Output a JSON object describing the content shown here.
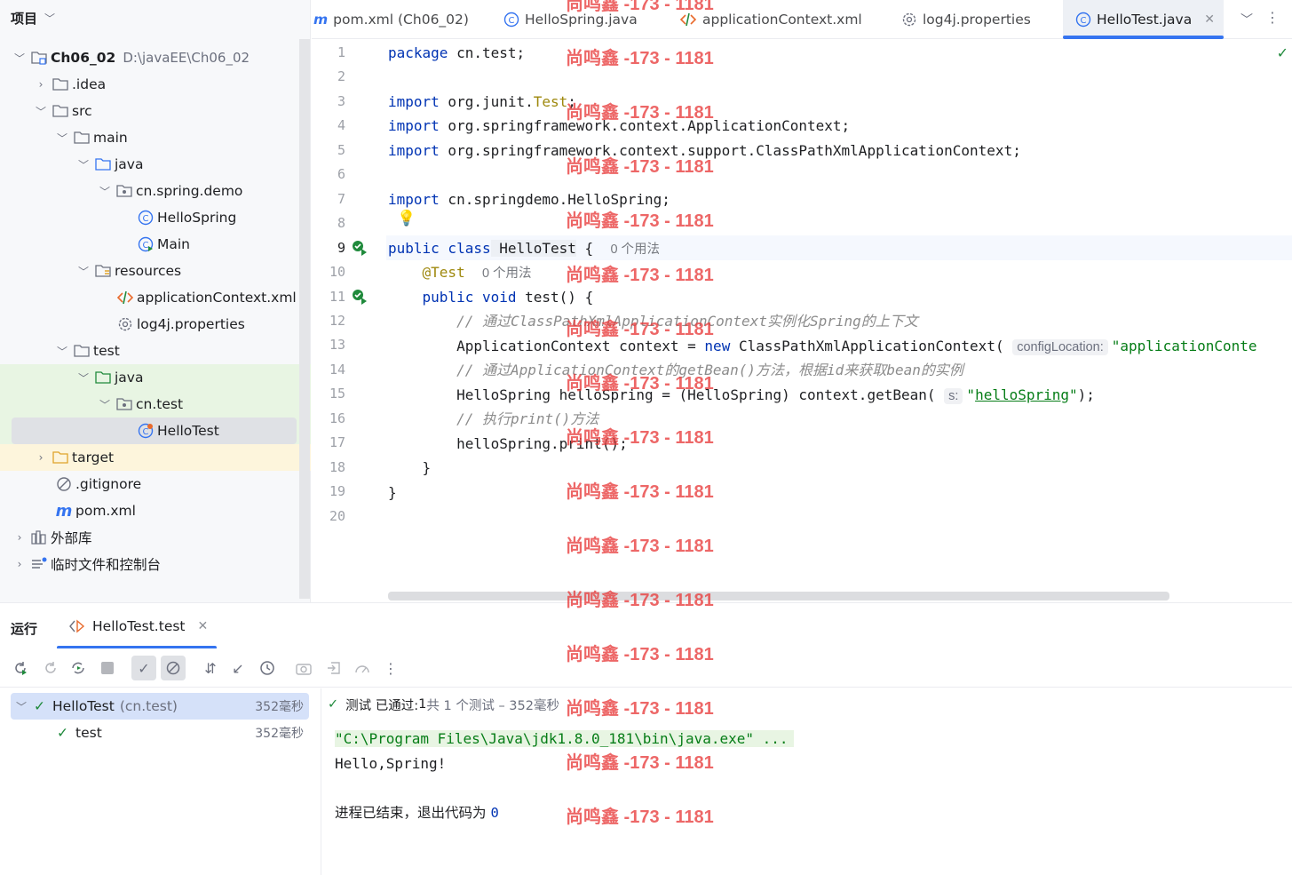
{
  "project": {
    "title": "项目",
    "tree": [
      {
        "label": "Ch06_02",
        "path": "D:\\javaEE\\Ch06_02"
      },
      {
        "label": ".idea"
      },
      {
        "label": "src"
      },
      {
        "label": "main"
      },
      {
        "label": "java"
      },
      {
        "label": "cn.spring.demo"
      },
      {
        "label": "HelloSpring"
      },
      {
        "label": "Main"
      },
      {
        "label": "resources"
      },
      {
        "label": "applicationContext.xml"
      },
      {
        "label": "log4j.properties"
      },
      {
        "label": "test"
      },
      {
        "label": "java"
      },
      {
        "label": "cn.test"
      },
      {
        "label": "HelloTest"
      },
      {
        "label": "target"
      },
      {
        "label": ".gitignore"
      },
      {
        "label": "pom.xml"
      },
      {
        "label": "外部库"
      },
      {
        "label": "临时文件和控制台"
      }
    ]
  },
  "tabs": [
    {
      "label": "pom.xml (Ch06_02)"
    },
    {
      "label": "HelloSpring.java"
    },
    {
      "label": "applicationContext.xml"
    },
    {
      "label": "log4j.properties"
    },
    {
      "label": "HelloTest.java"
    }
  ],
  "editor": {
    "line_numbers": [
      "1",
      "2",
      "3",
      "4",
      "5",
      "6",
      "7",
      "8",
      "9",
      "10",
      "11",
      "12",
      "13",
      "14",
      "15",
      "16",
      "17",
      "18",
      "19",
      "20"
    ],
    "usage_hint_class": "0 个用法",
    "usage_hint_test": "0 个用法",
    "inlay_config": "configLocation:",
    "inlay_s": "s:",
    "code": {
      "l1_kw": "package",
      "l1_rest": " cn.test;",
      "l3_kw": "import",
      "l3_rest": " org.junit.",
      "l3_an": "Test",
      "l3_end": ";",
      "l4_kw": "import",
      "l4_rest": " org.springframework.context.ApplicationContext;",
      "l5_kw": "import",
      "l5_rest": " org.springframework.context.support.ClassPathXmlApplicationContext;",
      "l7_kw": "import",
      "l7_rest": " cn.springdemo.HelloSpring;",
      "l9_kw": "public class",
      "l9_name": " HelloTest",
      "l9_rest": " {",
      "l10_an": "@Test",
      "l11_kw": "public void",
      "l11_rest": " test() {",
      "l12_cm": "// 通过ClassPathXmlApplicationContext实例化Spring的上下文",
      "l13_a": "ApplicationContext context = ",
      "l13_kw": "new",
      "l13_b": " ClassPathXmlApplicationContext(",
      "l13_str": "\"applicationConte",
      "l14_cm": "// 通过ApplicationContext的getBean()方法，根据id来获取bean的实例",
      "l15_a": "HelloSpring helloSpring = (HelloSpring) context.getBean(",
      "l15_q1": "\"",
      "l15_link": "helloSpring",
      "l15_q2": "\"",
      "l15_end": ");",
      "l16_cm": "// 执行print()方法",
      "l17": "helloSpring.print();",
      "l18": "}",
      "l19": "}"
    }
  },
  "run": {
    "title": "运行",
    "tab_label": "HelloTest.test",
    "tests": [
      {
        "name": "HelloTest",
        "pkg": "(cn.test)",
        "time": "352毫秒"
      },
      {
        "name": "test",
        "time": "352毫秒"
      }
    ],
    "status_passed": "测试 已通过: ",
    "status_count": "1",
    "status_detail": "共 1 个测试 – 352毫秒",
    "console": {
      "cmd": "\"C:\\Program Files\\Java\\jdk1.8.0_181\\bin\\java.exe\" ...",
      "output": "Hello,Spring!",
      "exit_text": "进程已结束，退出代码为 ",
      "exit_code": "0"
    }
  },
  "watermark": "尚鸣鑫 -173 - 1181"
}
